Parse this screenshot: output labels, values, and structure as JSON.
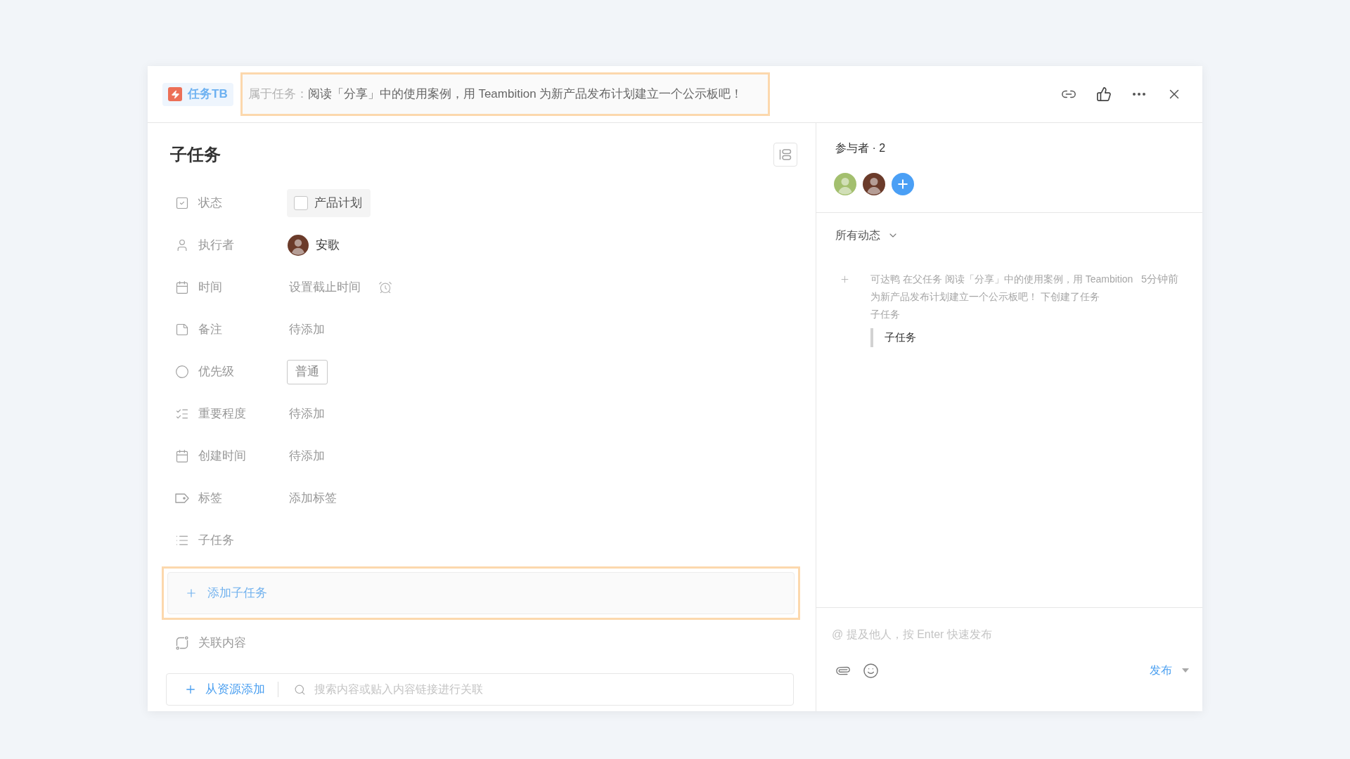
{
  "header": {
    "badge": "任务TB",
    "parent_task": {
      "prefix": "属于任务：",
      "title": "阅读「分享」中的使用案例，用 Teambition 为新产品发布计划建立一个公示板吧！",
      "highlighted": true
    }
  },
  "task": {
    "title": "子任务",
    "fields": [
      {
        "kind": "status",
        "label": "状态",
        "value": "产品计划",
        "checked": false
      },
      {
        "kind": "assignee",
        "label": "执行者",
        "value": "安歌"
      },
      {
        "kind": "time",
        "label": "时间",
        "placeholder": "设置截止时间"
      },
      {
        "kind": "note",
        "label": "备注",
        "placeholder": "待添加"
      },
      {
        "kind": "priority",
        "label": "优先级",
        "value": "普通"
      },
      {
        "kind": "importance",
        "label": "重要程度",
        "placeholder": "待添加"
      },
      {
        "kind": "created",
        "label": "创建时间",
        "placeholder": "待添加"
      },
      {
        "kind": "tags",
        "label": "标签",
        "placeholder": "添加标签"
      },
      {
        "kind": "subtasks",
        "label": "子任务"
      }
    ]
  },
  "add_subtask": {
    "label": "添加子任务",
    "highlighted": true
  },
  "related": {
    "label": "关联内容",
    "add_button": "从资源添加",
    "search_placeholder": "搜索内容或贴入内容链接进行关联"
  },
  "participants": {
    "title": "参与者 · 2",
    "avatars": [
      {
        "color": "#a3bf6e"
      },
      {
        "color": "#6b3b2a"
      }
    ]
  },
  "activity": {
    "filter": "所有动态",
    "items": [
      {
        "text": "可达鸭 在父任务 阅读「分享」中的使用案例，用 Teambition 为新产品发布计划建立一个公示板吧！ 下创建了任务",
        "task": "子任务",
        "time": "5分钟前",
        "quote": "子任务"
      }
    ]
  },
  "comment": {
    "placeholder": "@ 提及他人，按 Enter 快速发布",
    "submit": "发布"
  }
}
